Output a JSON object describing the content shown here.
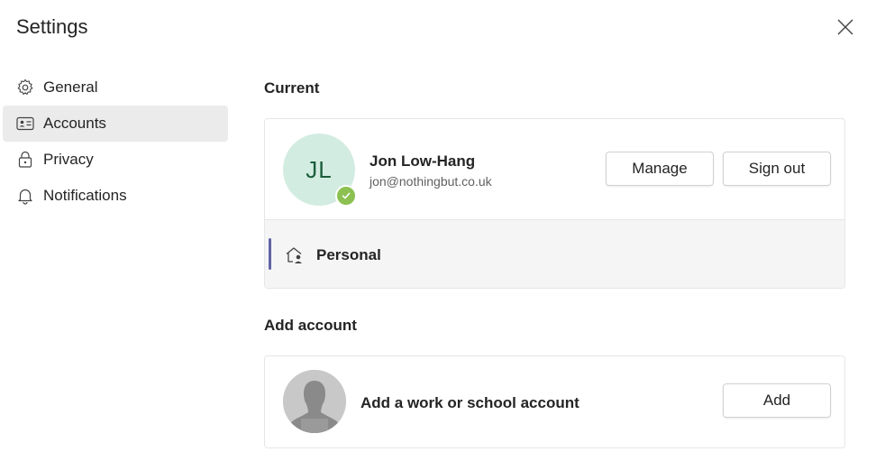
{
  "header": {
    "title": "Settings"
  },
  "nav": {
    "items": [
      {
        "label": "General",
        "icon": "gear-icon",
        "active": false
      },
      {
        "label": "Accounts",
        "icon": "id-card-icon",
        "active": true
      },
      {
        "label": "Privacy",
        "icon": "lock-icon",
        "active": false
      },
      {
        "label": "Notifications",
        "icon": "bell-icon",
        "active": false
      }
    ]
  },
  "current": {
    "section_title": "Current",
    "avatar_initials": "JL",
    "name": "Jon Low-Hang",
    "email": "jon@nothingbut.co.uk",
    "manage_label": "Manage",
    "signout_label": "Sign out",
    "org_label": "Personal",
    "presence": "available"
  },
  "add_account": {
    "section_title": "Add account",
    "description": "Add a work or school account",
    "add_label": "Add"
  },
  "colors": {
    "accent": "#6264a7",
    "presence_available": "#8cc152",
    "avatar_bg": "#d3ece1",
    "active_nav_bg": "#ebebeb"
  }
}
